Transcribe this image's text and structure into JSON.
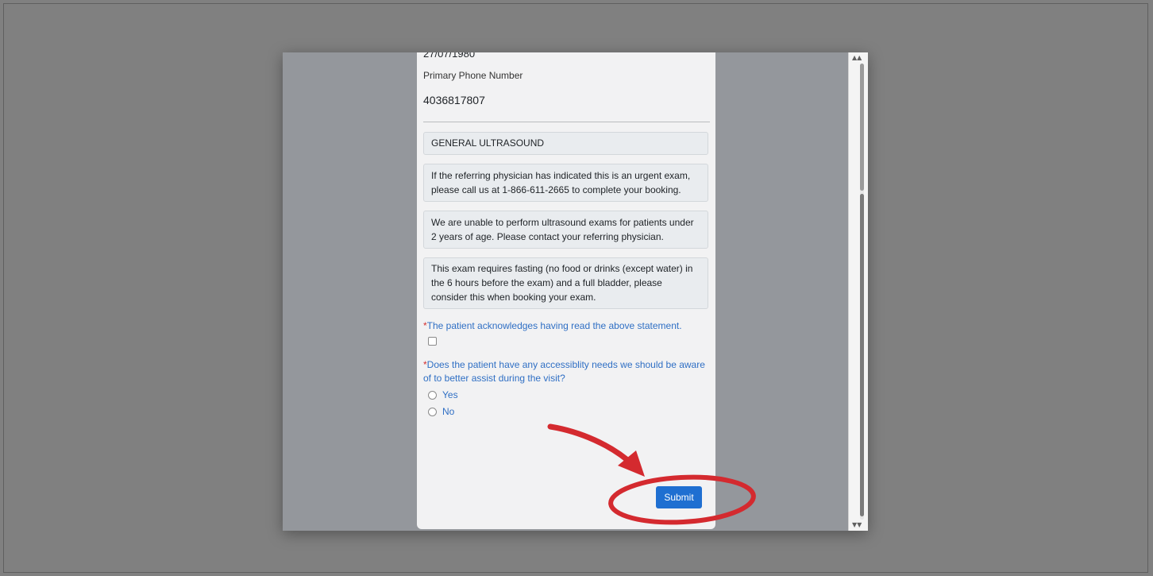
{
  "patient": {
    "dob_value": "27/07/1980",
    "phone_label": "Primary Phone Number",
    "phone_value": "4036817807"
  },
  "exam": {
    "title": "GENERAL ULTRASOUND",
    "notices": [
      "If the referring physician has indicated this is an urgent exam, please call us at 1-866-611-2665 to complete your booking.",
      "We are unable to perform ultrasound exams for patients under 2 years of age. Please contact your referring physician.",
      "This exam requires fasting (no food or drinks (except water) in the 6 hours before the exam) and a full bladder, please consider this when booking your exam."
    ]
  },
  "questions": {
    "required_marker": "*",
    "acknowledge": "The patient acknowledges having read the above statement.",
    "accessibility": "Does the patient have any accessiblity needs we should be aware of to better assist during the visit?",
    "options": [
      "Yes",
      "No"
    ]
  },
  "actions": {
    "submit_label": "Submit"
  },
  "annotation": {
    "color": "#d42a2f"
  }
}
